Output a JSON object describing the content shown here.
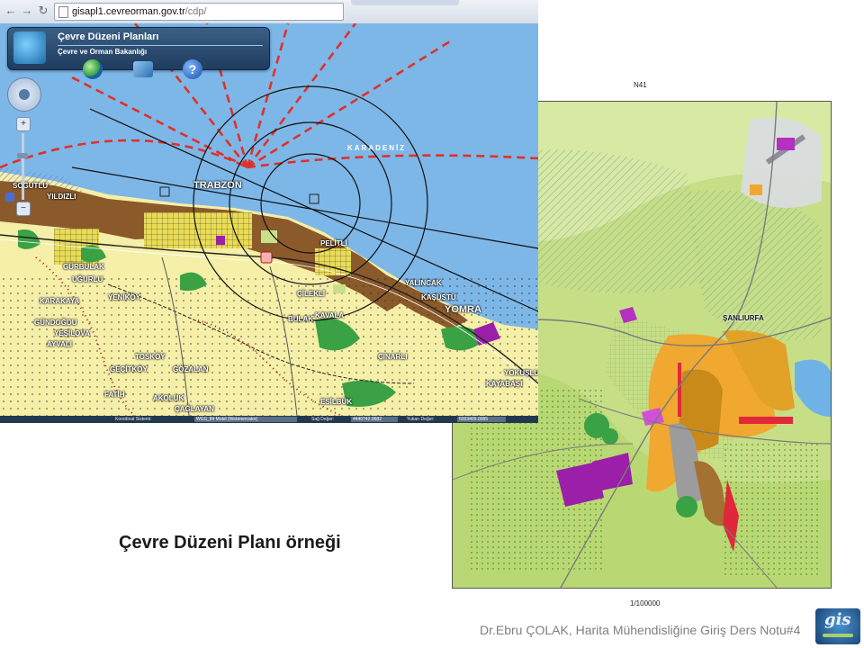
{
  "browser": {
    "url_host": "gisapl1.cevreorman.gov.tr",
    "url_path": "/cdp/"
  },
  "app": {
    "title": "Çevre Düzeni Planları",
    "subtitle": "Çevre ve Orman Bakanlığı",
    "help_symbol": "?"
  },
  "map_labels": {
    "sea": "KARADENİZ",
    "city": "TRABZON",
    "places": [
      "SOĞUTLU",
      "YILDIZLI",
      "GÜRBULAK",
      "UĞURLU",
      "YENİKÖY",
      "KARAKAYA",
      "GÜNDOĞDU",
      "YEŞİLOVA",
      "AYVALI",
      "TOSKÖY",
      "GEÇİTKÖY",
      "GÖZALAN",
      "FATİH",
      "AKOLUK",
      "ÇAĞLAYAN",
      "ÇİLEKLİ",
      "BULAK",
      "KAVALA",
      "YALINCAK",
      "KAŞÜSTÜ",
      "YOMRA",
      "ÇINARLI",
      "YOKUŞLU",
      "KAYABAŞI",
      "ESİLBÜK",
      "PELİTLİ"
    ]
  },
  "status": {
    "coordinate_system_label": "Koordinat Sistemi:",
    "coordinate_system_value": "WGS_84 Mobil (Webmercator)",
    "right_label": "Sağ Değer:",
    "right_value": "4440742.9682",
    "top_label": "Yukarı Değer:",
    "top_value": "5003409.0085"
  },
  "map2": {
    "sheet": "N41",
    "city": "ŞANLIURFA",
    "scale": "1/100000"
  },
  "slide": {
    "caption": "Çevre Düzeni Planı örneği",
    "footer": "Dr.Ebru ÇOLAK, Harita Mühendisliğine Giriş Ders Notu#4",
    "logo_text": "gis"
  },
  "colors": {
    "sea": "#7db7e8",
    "land": "#f5efa8",
    "urban": "#8b5a2b",
    "forest": "#3aa144",
    "red_dashed": "#e0302a",
    "map2_green": "#c9e08a",
    "map2_orange": "#f0a830",
    "map2_purple": "#9b1fa8"
  }
}
